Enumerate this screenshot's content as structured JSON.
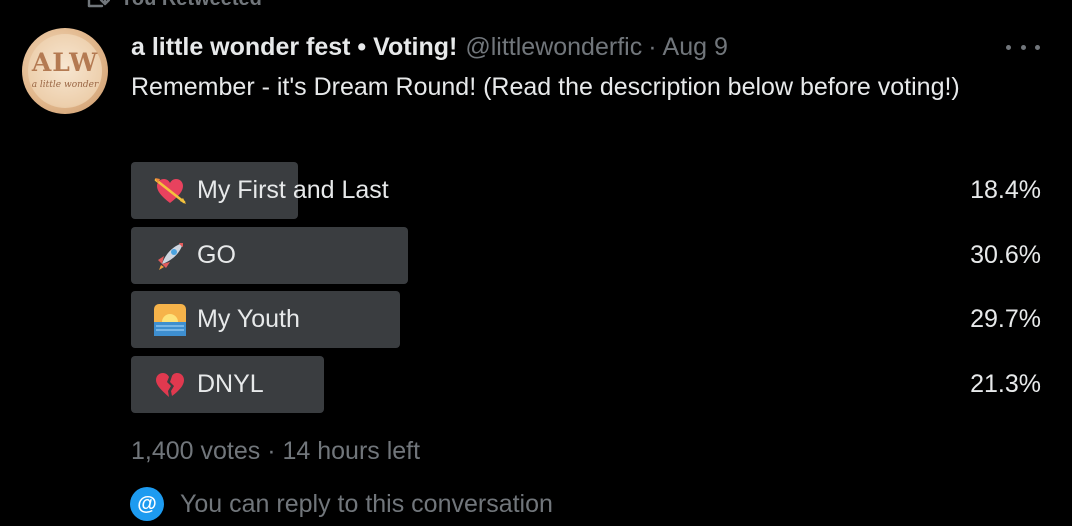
{
  "retweet_context": {
    "text": "You Retweeted",
    "icon": "retweet-icon"
  },
  "tweet": {
    "display_name": "a little wonder fest • Voting!",
    "handle": "@littlewonderfic",
    "separator": "·",
    "date": "Aug 9",
    "avatar": {
      "logo_text": "ALW",
      "logo_subtext": "a little wonder"
    },
    "text": "Remember - it's Dream Round! (Read the description below before voting!)",
    "more_icon": "more-horizontal-icon"
  },
  "poll": {
    "options": [
      {
        "label": "My First and Last",
        "percent_text": "18.4%",
        "percent": 18.4,
        "emoji": "heart-with-arrow-icon"
      },
      {
        "label": "GO",
        "percent_text": "30.6%",
        "percent": 30.6,
        "emoji": "rocket-icon"
      },
      {
        "label": "My Youth",
        "percent_text": "29.7%",
        "percent": 29.7,
        "emoji": "sunrise-over-sea-icon"
      },
      {
        "label": "DNYL",
        "percent_text": "21.3%",
        "percent": 21.3,
        "emoji": "broken-heart-icon"
      }
    ],
    "meta": "1,400 votes · 14 hours left"
  },
  "reply_restriction": {
    "icon": "at-sign-icon",
    "icon_glyph": "@",
    "text": "You can reply to this conversation"
  },
  "colors": {
    "background": "#000000",
    "text_primary": "#e7e9ea",
    "text_secondary": "#71767b",
    "poll_bar": "#3a3d40",
    "accent": "#1d9bf0"
  }
}
